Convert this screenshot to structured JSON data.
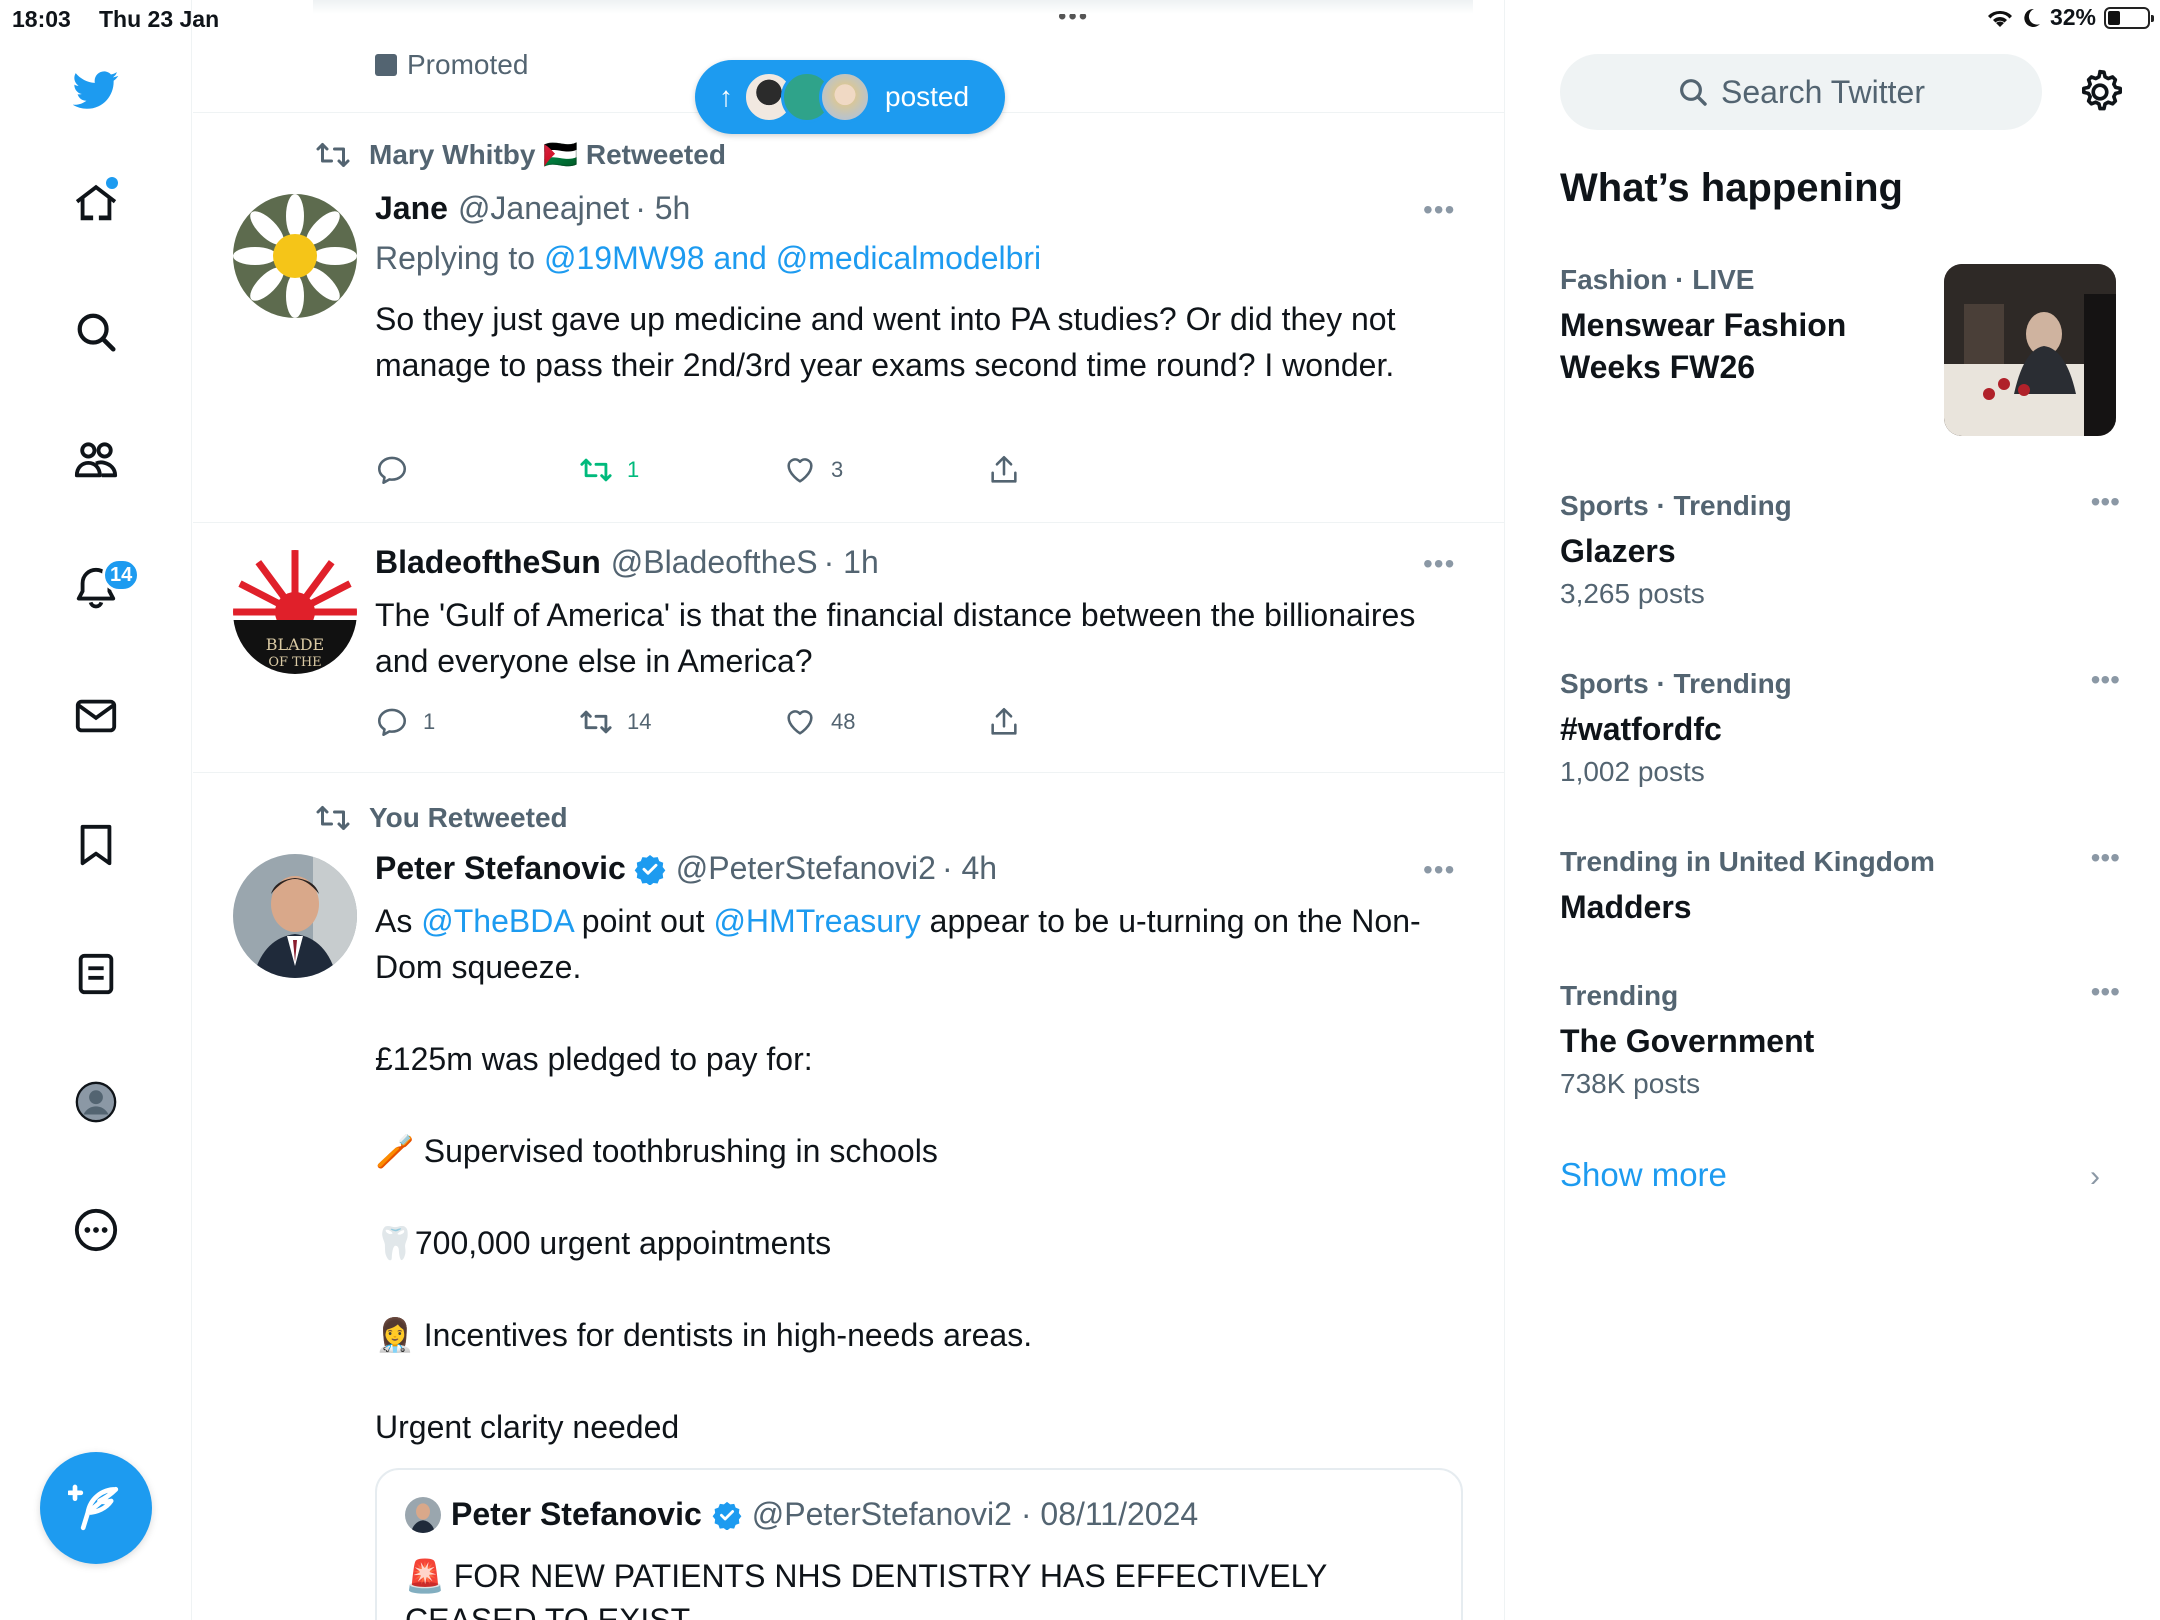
{
  "status_bar": {
    "time": "18:03",
    "date": "Thu 23 Jan",
    "battery": "32%",
    "battery_level": 0.32
  },
  "sidebar": {
    "items": [
      {
        "name": "home",
        "icon": "home-icon"
      },
      {
        "name": "explore",
        "icon": "search-icon"
      },
      {
        "name": "communities",
        "icon": "people-icon"
      },
      {
        "name": "notifications",
        "icon": "bell-icon",
        "badge": "14"
      },
      {
        "name": "messages",
        "icon": "mail-icon"
      },
      {
        "name": "bookmarks",
        "icon": "bookmark-icon"
      },
      {
        "name": "lists",
        "icon": "list-icon"
      },
      {
        "name": "profile",
        "icon": "profile-icon"
      },
      {
        "name": "more",
        "icon": "more-icon"
      }
    ],
    "accent": "#1d9bf0"
  },
  "feed": {
    "promoted_label": "Promoted",
    "new_posts_pill": "posted",
    "tweets": [
      {
        "retweeted_by": "Mary Whitby 🇵🇸 Retweeted",
        "name": "Jane",
        "handle": "@Janeajnet",
        "time": "· 5h",
        "replying_prefix": "Replying to",
        "replying_to": "@19MW98 and @medicalmodelbri",
        "text": "So they just gave up medicine and went into PA studies? Or did they not manage to pass their 2nd/3rd year exams second time round? I wonder.",
        "replies": "",
        "retweets": "1",
        "likes": "3"
      },
      {
        "name": "BladeoftheSun",
        "handle": "@BladeoftheS",
        "time": "· 1h",
        "text": "The 'Gulf of America' is that the financial distance between the billionaires and everyone else in America?",
        "replies": "1",
        "retweets": "14",
        "likes": "48"
      },
      {
        "retweeted_by": "You Retweeted",
        "name": "Peter Stefanovic",
        "handle": "@PeterStefanovi2",
        "time": "· 4h",
        "text_as": "As",
        "mention1": "@TheBDA",
        "text_point": "point out",
        "mention2": "@HMTreasury",
        "text_rest": "appear to be u-turning on the Non-Dom squeeze.",
        "line_pledged": "£125m was pledged to pay for:",
        "line1": "🪥 Supervised toothbrushing in schools",
        "line2": "🦷700,000 urgent appointments",
        "line3": "👩‍⚕️ Incentives for dentists in high-needs areas.",
        "line_urgent": "Urgent clarity needed",
        "quote": {
          "name": "Peter Stefanovic",
          "handle": "@PeterStefanovi2 · 08/11/2024",
          "text": "🚨 FOR NEW PATIENTS NHS DENTISTRY HAS EFFECTIVELY CEASED TO EXIST"
        }
      }
    ]
  },
  "right": {
    "search_placeholder": "Search Twitter",
    "whats_happening": "What’s happening",
    "trends": [
      {
        "category": "Fashion · LIVE",
        "title": "Menswear Fashion Weeks FW26",
        "count": ""
      },
      {
        "category": "Sports · Trending",
        "title": "Glazers",
        "count": "3,265 posts"
      },
      {
        "category": "Sports · Trending",
        "title": "#watfordfc",
        "count": "1,002 posts"
      },
      {
        "category": "Trending in United Kingdom",
        "title": "Madders",
        "count": ""
      },
      {
        "category": "Trending",
        "title": "The Government",
        "count": "738K posts"
      }
    ],
    "show_more": "Show more"
  }
}
